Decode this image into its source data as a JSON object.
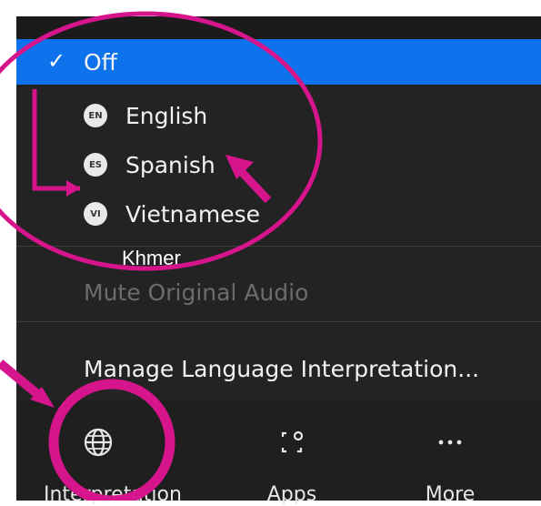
{
  "menu": {
    "selected": {
      "check": "✓",
      "label": "Off"
    },
    "languages": [
      {
        "badge": "EN",
        "label": "English"
      },
      {
        "badge": "ES",
        "label": "Spanish"
      },
      {
        "badge": "VI",
        "label": "Vietnamese"
      }
    ],
    "added_language": "Khmer",
    "mute_original_audio": "Mute Original Audio",
    "manage": "Manage Language Interpretation..."
  },
  "toolbar": [
    {
      "label": "Interpretation",
      "icon": "globe-icon"
    },
    {
      "label": "Apps",
      "icon": "apps-icon"
    },
    {
      "label": "More",
      "icon": "more-icon"
    }
  ],
  "annotation_color": "#d6148c"
}
